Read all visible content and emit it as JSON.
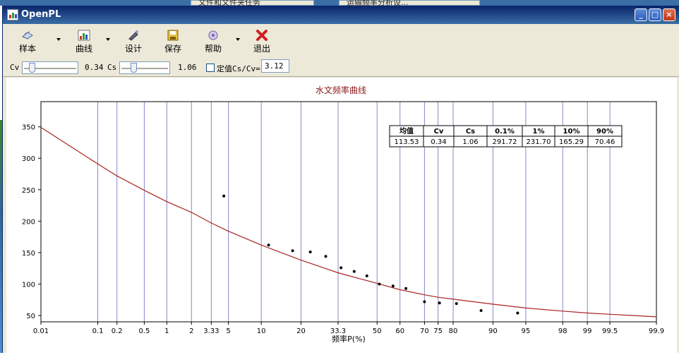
{
  "background": {
    "tabs": [
      "",
      "文件和文件夹任务",
      "",
      "运输频率分析设..."
    ]
  },
  "window": {
    "title": "OpenPL",
    "controls": {
      "minimize": "_",
      "maximize": "□",
      "close": "×"
    }
  },
  "toolbar": {
    "items": [
      {
        "label": "样本",
        "icon": "sample-icon",
        "dropdown": true
      },
      {
        "label": "曲线",
        "icon": "curve-icon",
        "dropdown": true
      },
      {
        "label": "设计",
        "icon": "design-icon",
        "dropdown": false
      },
      {
        "label": "保存",
        "icon": "save-icon",
        "dropdown": false
      },
      {
        "label": "帮助",
        "icon": "help-icon",
        "dropdown": true
      },
      {
        "label": "退出",
        "icon": "exit-icon",
        "dropdown": false
      }
    ]
  },
  "params": {
    "cv_label": "Cv",
    "cv_value": "0.34",
    "cv_fraction": 0.1,
    "cs_label": "Cs",
    "cs_value": "1.06",
    "cs_fraction": 0.22,
    "fixed_label": "定值Cs/Cv=",
    "fixed_checked": false,
    "ratio_value": "3.12"
  },
  "chart_data": {
    "type": "line",
    "title": "水文频率曲线",
    "xlabel": "频率P(%)",
    "ylabel": "",
    "x_scale": "probability",
    "x_ticks": [
      0.01,
      0.1,
      0.2,
      0.5,
      1,
      2,
      3.33,
      5,
      10,
      20,
      33.3,
      50,
      60,
      70,
      75,
      80,
      90,
      95,
      98,
      99,
      99.5,
      99.9
    ],
    "x_tick_labels": [
      "0.01",
      "0.1",
      "0.2",
      "0.5",
      "1",
      "2",
      "3.33",
      "5",
      "10",
      "20",
      "33.3",
      "50",
      "60",
      "70",
      "75",
      "80",
      "90",
      "95",
      "98",
      "99",
      "99.5",
      "99.9"
    ],
    "y_ticks": [
      50,
      100,
      150,
      200,
      250,
      300,
      350
    ],
    "ylim": [
      40,
      390
    ],
    "grid": "vertical",
    "series": [
      {
        "kind": "curve",
        "color": "#aa2222",
        "x": [
          0.01,
          0.1,
          0.2,
          0.5,
          1,
          2,
          3.33,
          5,
          10,
          20,
          33.3,
          50,
          60,
          70,
          75,
          80,
          90,
          95,
          98,
          99,
          99.5,
          99.9
        ],
        "y": [
          349,
          291,
          272,
          249,
          231,
          214,
          197,
          184,
          162,
          138,
          118,
          101,
          91,
          83,
          79,
          76,
          68,
          62,
          57,
          54,
          52,
          48
        ]
      },
      {
        "kind": "points",
        "color": "#000000",
        "x": [
          4.5,
          11.5,
          17.5,
          23,
          28.5,
          34.5,
          40,
          45.5,
          51,
          57,
          62.5,
          70,
          75.5,
          81,
          87.5,
          94
        ],
        "y": [
          240,
          162,
          153,
          151,
          144,
          126,
          120,
          113,
          100,
          97,
          93,
          72,
          70,
          69,
          58,
          54
        ]
      }
    ],
    "table": {
      "headers": [
        "均值",
        "Cv",
        "Cs",
        "0.1%",
        "1%",
        "10%",
        "90%"
      ],
      "values": [
        "113.53",
        "0.34",
        "1.06",
        "291.72",
        "231.70",
        "165.29",
        "70.46"
      ]
    }
  }
}
